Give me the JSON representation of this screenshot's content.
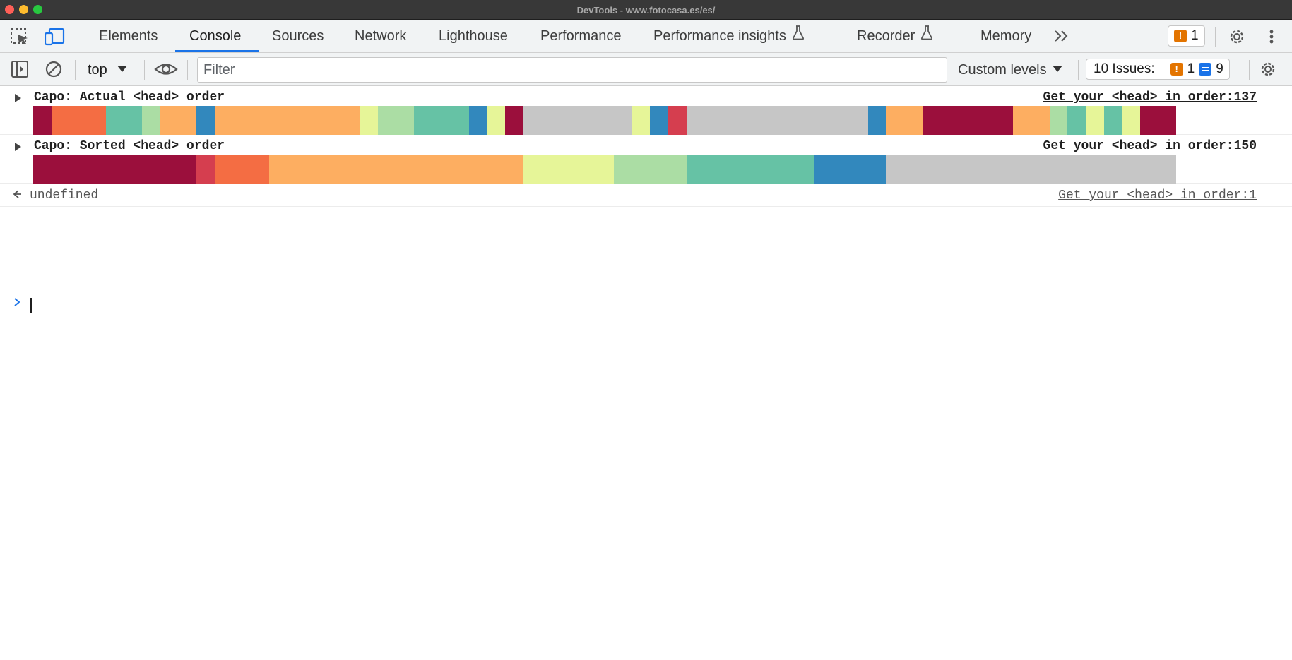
{
  "window": {
    "title": "DevTools - www.fotocasa.es/es/"
  },
  "tabs": [
    {
      "label": "Elements"
    },
    {
      "label": "Console"
    },
    {
      "label": "Sources"
    },
    {
      "label": "Network"
    },
    {
      "label": "Lighthouse"
    },
    {
      "label": "Performance"
    },
    {
      "label": "Performance insights"
    },
    {
      "label": "Recorder"
    },
    {
      "label": "Memory"
    }
  ],
  "active_tab": "Console",
  "header_issue_badge": {
    "count": "1"
  },
  "toolbar": {
    "context": "top",
    "filter_placeholder": "Filter",
    "levels": "Custom levels",
    "issues_label": "10 Issues:",
    "issues_warnings": "1",
    "issues_info": "9"
  },
  "palette": {
    "crimson": "#9b0f3c",
    "red": "#d53e4f",
    "coral": "#f46d43",
    "orange": "#fdae61",
    "yellow": "#e6f598",
    "lightgreen": "#abdda4",
    "teal": "#66c2a5",
    "blue": "#3288bd",
    "gray": "#c6c6c6"
  },
  "console": {
    "messages": [
      {
        "title": "Capo: Actual <head> order",
        "source": "Get your <head> in order:137",
        "segments": [
          "crimson",
          "coral",
          "coral",
          "coral",
          "teal",
          "teal",
          "lightgreen",
          "orange",
          "orange",
          "blue",
          "orange",
          "orange",
          "orange",
          "orange",
          "orange",
          "orange",
          "orange",
          "orange",
          "yellow",
          "lightgreen",
          "lightgreen",
          "teal",
          "teal",
          "teal",
          "blue",
          "yellow",
          "crimson",
          "gray",
          "gray",
          "gray",
          "gray",
          "gray",
          "gray",
          "yellow",
          "blue",
          "red",
          "gray",
          "gray",
          "gray",
          "gray",
          "gray",
          "gray",
          "gray",
          "gray",
          "gray",
          "gray",
          "blue",
          "orange",
          "orange",
          "crimson",
          "crimson",
          "crimson",
          "crimson",
          "crimson",
          "orange",
          "orange",
          "lightgreen",
          "teal",
          "yellow",
          "teal",
          "yellow",
          "crimson",
          "crimson"
        ]
      },
      {
        "title": "Capo: Sorted <head> order",
        "source": "Get your <head> in order:150",
        "segments": [
          "crimson",
          "crimson",
          "crimson",
          "crimson",
          "crimson",
          "crimson",
          "crimson",
          "crimson",
          "crimson",
          "red",
          "coral",
          "coral",
          "coral",
          "orange",
          "orange",
          "orange",
          "orange",
          "orange",
          "orange",
          "orange",
          "orange",
          "orange",
          "orange",
          "orange",
          "orange",
          "orange",
          "orange",
          "yellow",
          "yellow",
          "yellow",
          "yellow",
          "yellow",
          "lightgreen",
          "lightgreen",
          "lightgreen",
          "lightgreen",
          "teal",
          "teal",
          "teal",
          "teal",
          "teal",
          "teal",
          "teal",
          "blue",
          "blue",
          "blue",
          "blue",
          "gray",
          "gray",
          "gray",
          "gray",
          "gray",
          "gray",
          "gray",
          "gray",
          "gray",
          "gray",
          "gray",
          "gray",
          "gray",
          "gray",
          "gray",
          "gray"
        ]
      }
    ],
    "result": {
      "value": "undefined",
      "source": "Get your <head> in order:1"
    }
  }
}
